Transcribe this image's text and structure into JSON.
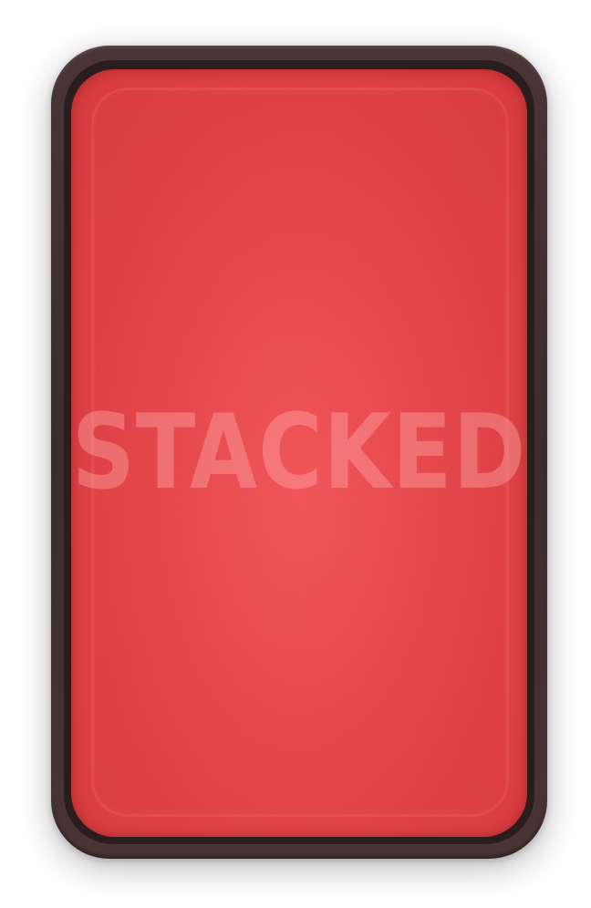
{
  "card": {
    "back_logo_text": "STACKED",
    "face_color": "#e84a4e",
    "frame_color": "#3d2c2d"
  }
}
